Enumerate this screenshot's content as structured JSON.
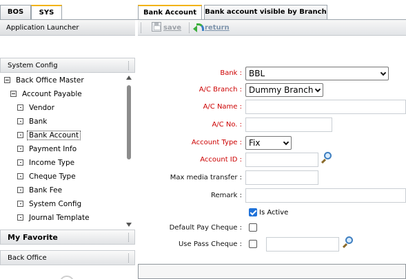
{
  "top_tabs": [
    {
      "label": "BOS",
      "active": false
    },
    {
      "label": "SYS",
      "active": true
    }
  ],
  "launcher": {
    "title": "Application Launcher"
  },
  "left_sections": {
    "system_config": "System Config",
    "my_favorite": "My Favorite",
    "back_office": "Back Office"
  },
  "tree": {
    "root": "Back Office Master",
    "group": "Account Payable",
    "items": [
      "Vendor",
      "Bank",
      "Bank Account",
      "Payment Info",
      "Income Type",
      "Cheque Type",
      "Bank Fee",
      "System Config",
      "Journal Template"
    ],
    "selected": "Bank Account"
  },
  "right_tabs": [
    {
      "label": "Bank Account",
      "active": true
    },
    {
      "label": "Bank account visible by Branch",
      "active": false
    }
  ],
  "toolbar": {
    "save_label": "save",
    "return_label": "return",
    "save_enabled": false
  },
  "form": {
    "bank": {
      "label": "Bank :",
      "value": "BBL",
      "required": true
    },
    "branch": {
      "label": "A/C Branch :",
      "value": "Dummy Branch",
      "required": true
    },
    "ac_name": {
      "label": "A/C Name :",
      "value": "",
      "required": true
    },
    "ac_no": {
      "label": "A/C No. :",
      "value": "",
      "required": true
    },
    "account_type": {
      "label": "Account Type :",
      "value": "Fix",
      "required": true
    },
    "account_id": {
      "label": "Account ID :",
      "value": "",
      "required": true
    },
    "max_media_transfer": {
      "label": "Max media transfer :",
      "value": "",
      "required": false
    },
    "remark": {
      "label": "Remark :",
      "value": "",
      "required": false
    },
    "is_active": {
      "label": "Is Active",
      "checked": true
    },
    "default_pay_cheque": {
      "label": "Default Pay Cheque :",
      "checked": false
    },
    "use_pass_cheque": {
      "label": "Use Pass Cheque :",
      "checked": false,
      "value": ""
    }
  },
  "icons": {
    "save": "floppy-disk-icon",
    "return": "return-arrow-icon",
    "lookup": "magnifier-icon"
  },
  "colors": {
    "required_label": "#cc0000",
    "active_tab_accent": "#f2b200",
    "checkbox_checked": "#1f72d9"
  }
}
